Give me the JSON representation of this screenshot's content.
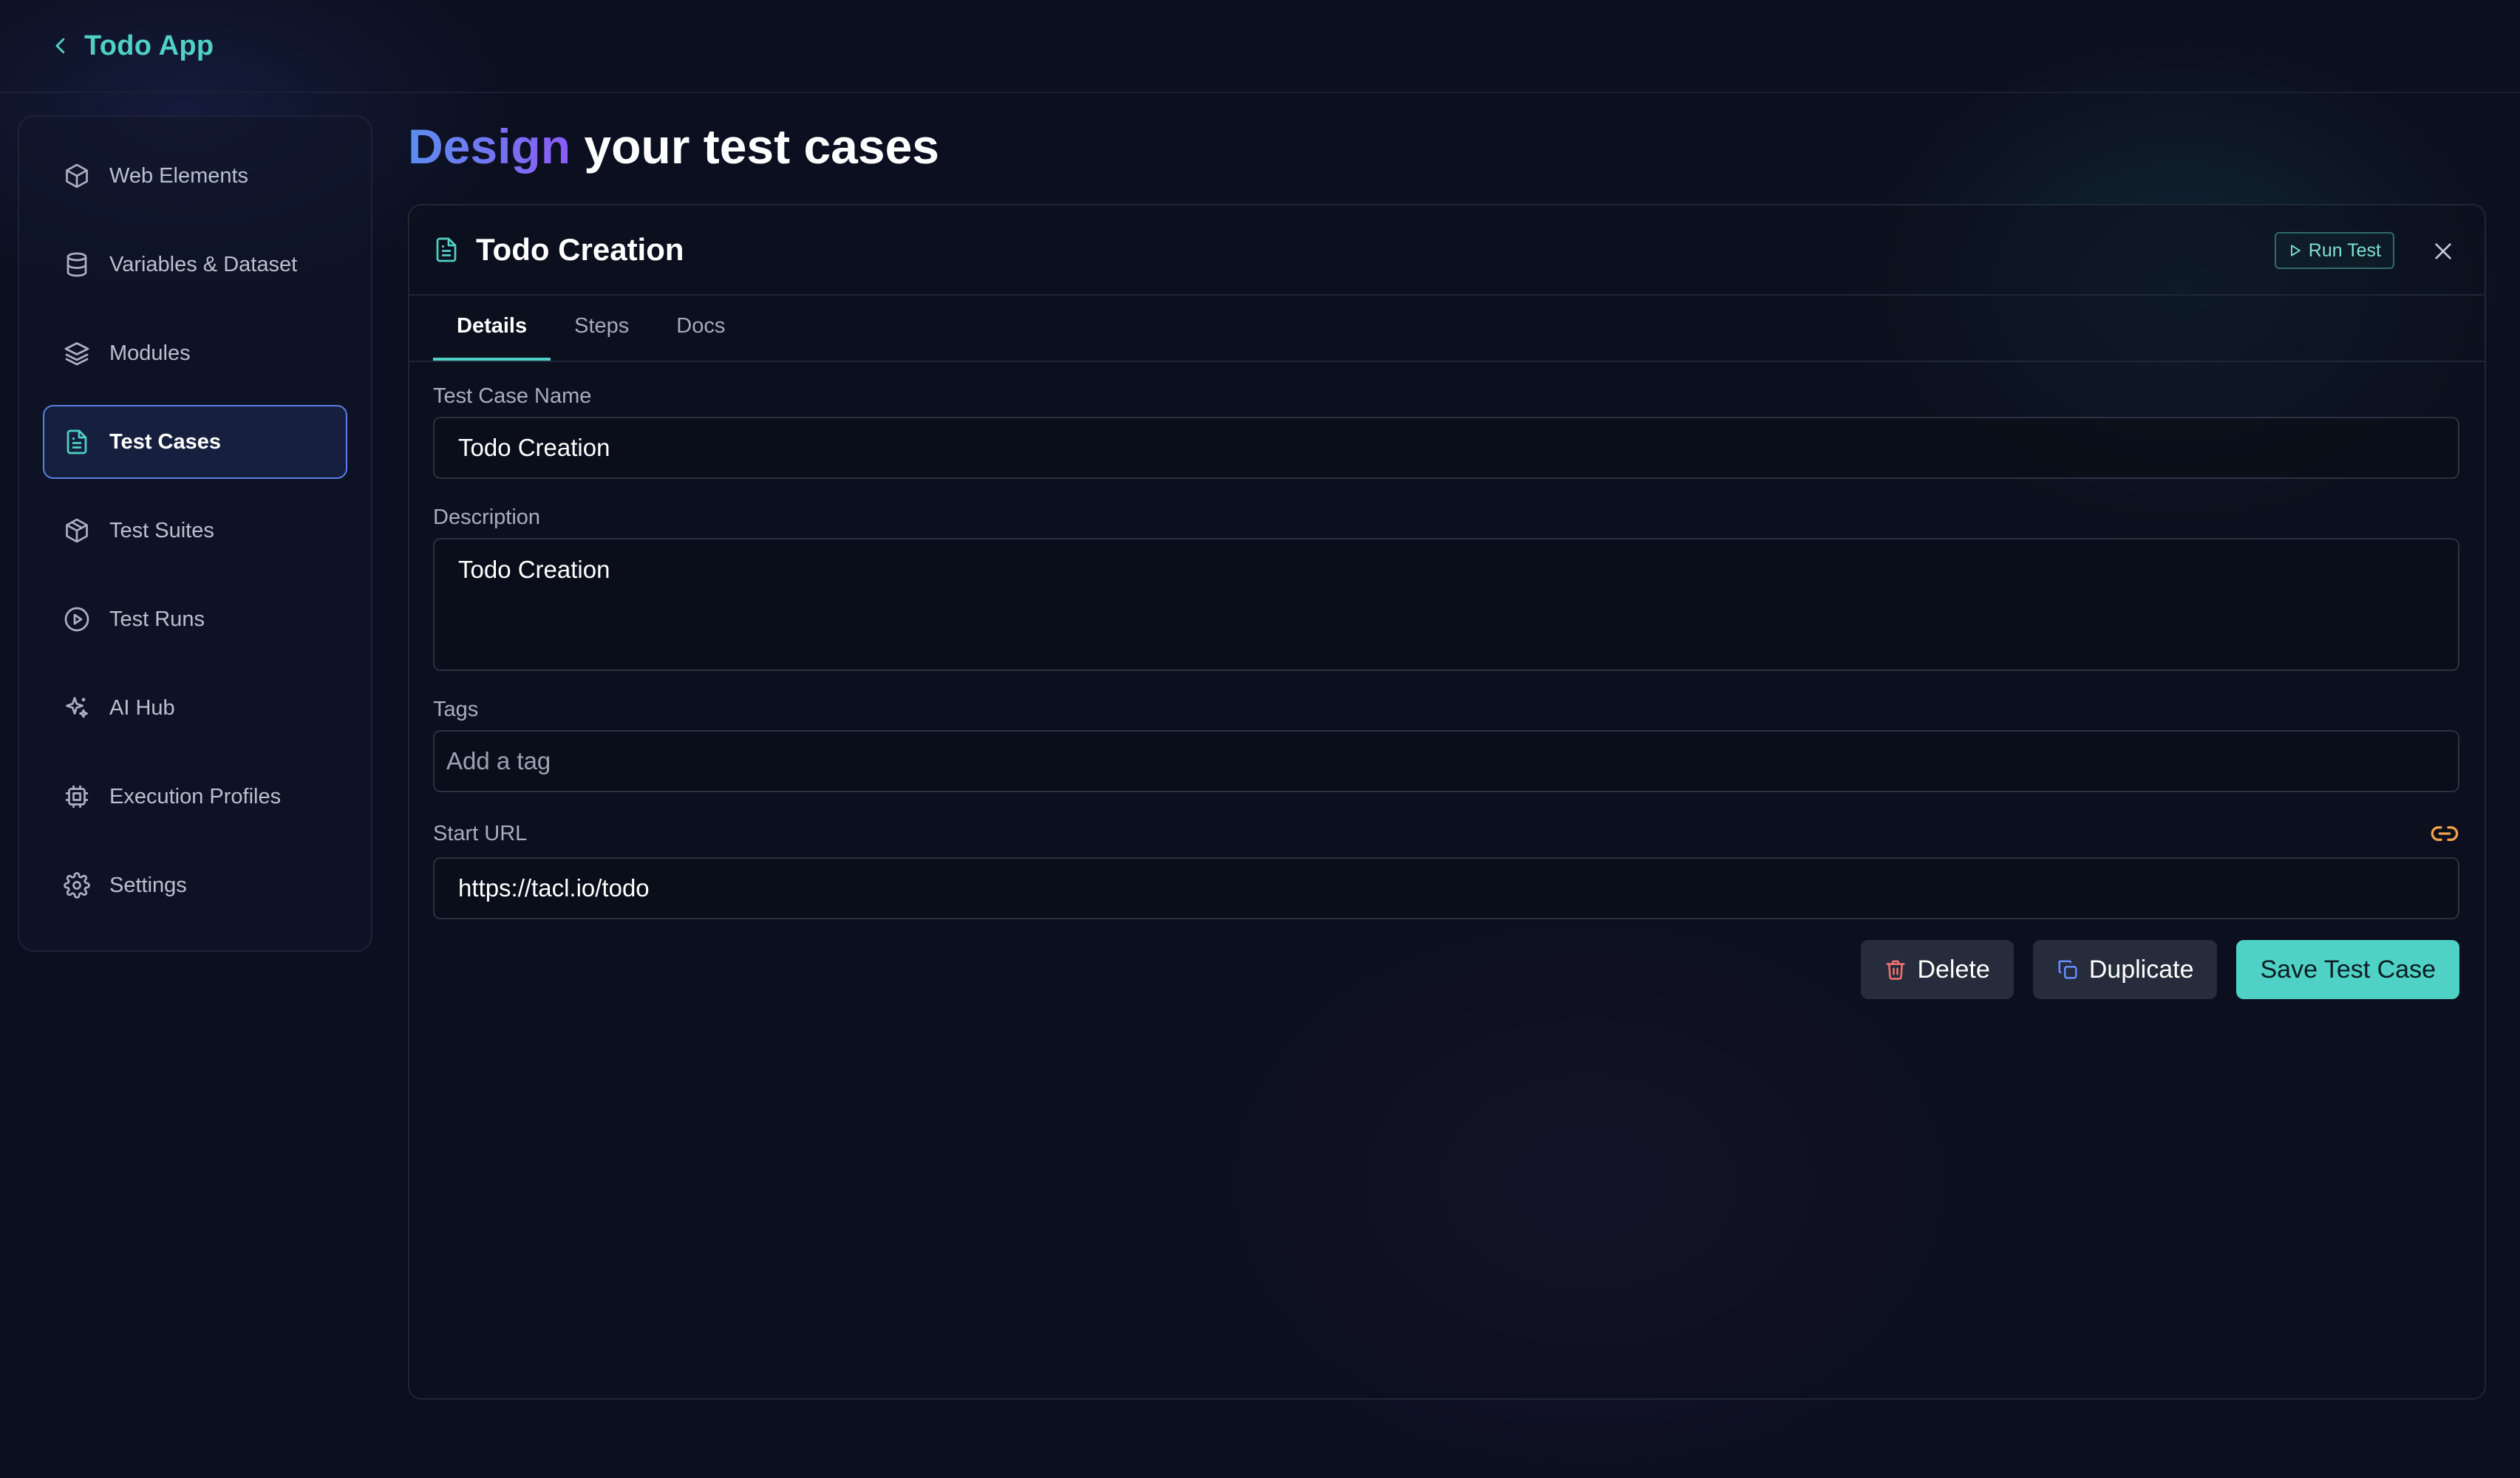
{
  "app": {
    "title": "Todo App"
  },
  "sidebar": {
    "items": [
      {
        "label": "Web Elements",
        "icon": "cube-icon"
      },
      {
        "label": "Variables & Dataset",
        "icon": "database-icon"
      },
      {
        "label": "Modules",
        "icon": "layers-icon"
      },
      {
        "label": "Test Cases",
        "icon": "document-icon",
        "active": true
      },
      {
        "label": "Test Suites",
        "icon": "package-icon"
      },
      {
        "label": "Test Runs",
        "icon": "play-circle-icon"
      },
      {
        "label": "AI Hub",
        "icon": "sparkles-icon"
      },
      {
        "label": "Execution Profiles",
        "icon": "cpu-icon"
      },
      {
        "label": "Settings",
        "icon": "gear-icon"
      }
    ]
  },
  "heading": {
    "accent": "Design",
    "rest": " your test cases"
  },
  "card": {
    "title": "Todo Creation",
    "run_test_label": "Run Test",
    "tabs": [
      {
        "label": "Details",
        "active": true
      },
      {
        "label": "Steps"
      },
      {
        "label": "Docs"
      }
    ]
  },
  "form": {
    "name_label": "Test Case Name",
    "name_value": "Todo Creation",
    "description_label": "Description",
    "description_value": "Todo Creation",
    "tags_label": "Tags",
    "tags_placeholder": "Add a tag",
    "url_label": "Start URL",
    "url_value": "https://tacl.io/todo"
  },
  "actions": {
    "delete_label": "Delete",
    "duplicate_label": "Duplicate",
    "save_label": "Save Test Case"
  },
  "colors": {
    "accent": "#4fd1c5",
    "active_border": "#5b7ee5",
    "danger": "#f87171",
    "link": "#f0a24a"
  }
}
